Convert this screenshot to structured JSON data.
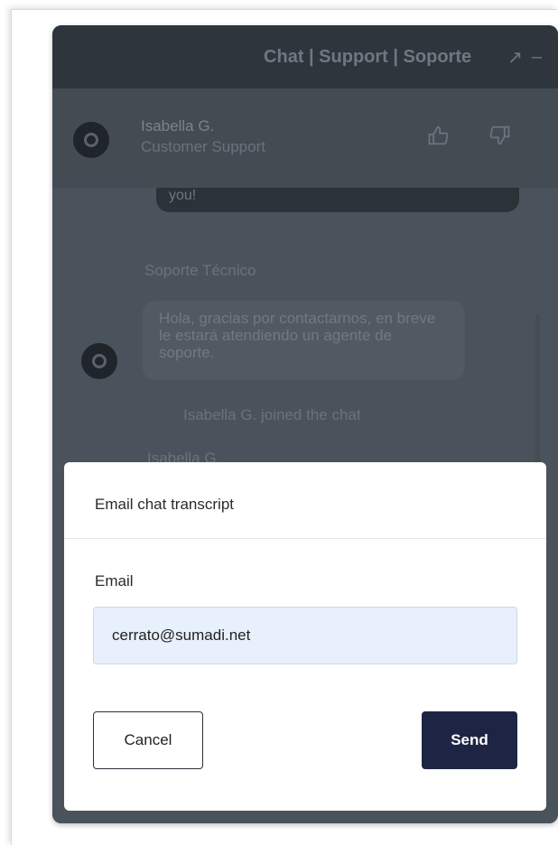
{
  "window": {
    "title": "Chat | Support | Soporte",
    "popout_icon": "↗",
    "minimize_icon": "–"
  },
  "agent": {
    "name": "Isabella G.",
    "role": "Customer Support"
  },
  "messages": {
    "partial_bubble_text": "you!",
    "sender_label": "Soporte Técnico",
    "bubble_text": "Hola, gracias por contactarnos, en breve le estará atendiendo un agente de soporte.",
    "system_text": "Isabella G. joined the chat",
    "next_sender": "Isabella G."
  },
  "modal": {
    "title": "Email chat transcript",
    "email_label": "Email",
    "email_value": "cerrato@sumadi.net",
    "cancel_label": "Cancel",
    "send_label": "Send"
  },
  "colors": {
    "titlebar": "#2e353d",
    "overlay": "#4a535b",
    "send_button": "#1e2544",
    "input_bg": "#e8f0fc"
  }
}
